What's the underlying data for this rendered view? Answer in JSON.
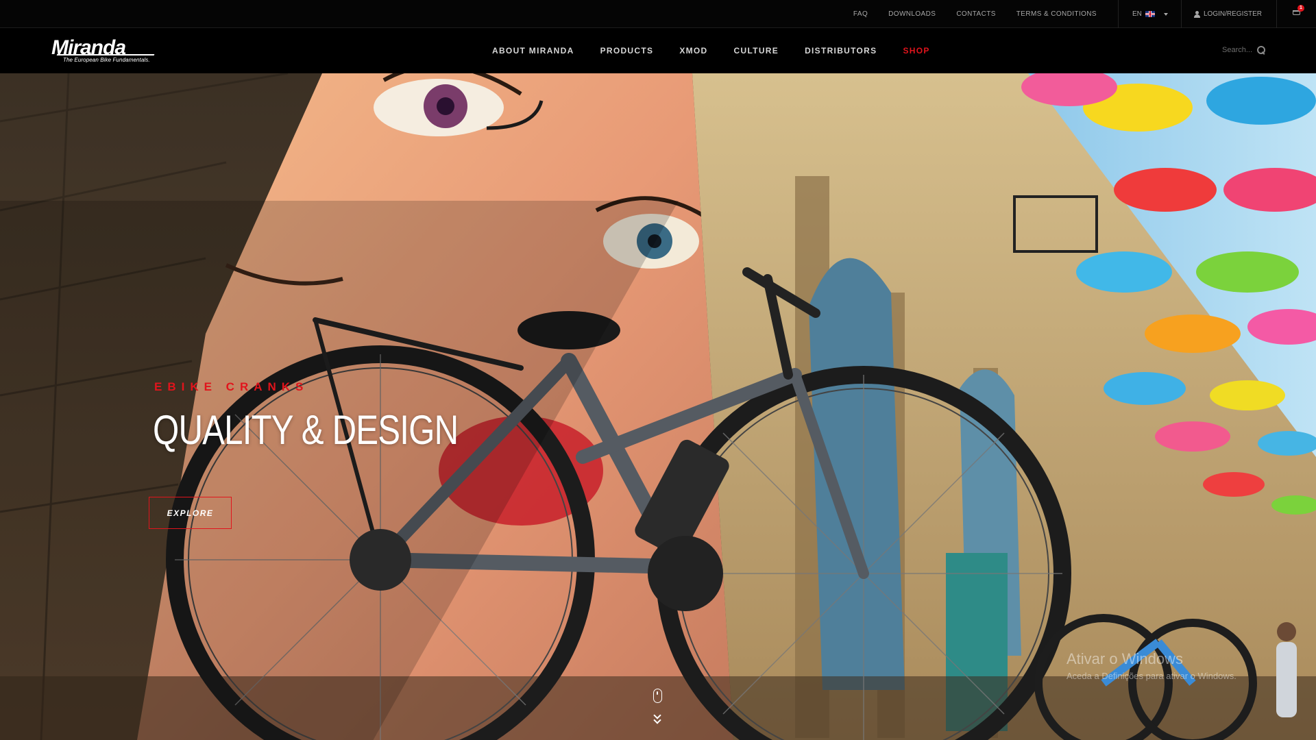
{
  "topbar": {
    "links": [
      "FAQ",
      "DOWNLOADS",
      "CONTACTS",
      "TERMS & CONDITIONS"
    ],
    "language": "EN",
    "login_label": "LOGIN/REGISTER",
    "cart_count": "1"
  },
  "nav": {
    "logo_word": "Miranda",
    "logo_tagline": "The European Bike Fundamentals.",
    "items": [
      "ABOUT MIRANDA",
      "PRODUCTS",
      "XMOD",
      "CULTURE",
      "DISTRIBUTORS",
      "SHOP"
    ],
    "search_placeholder": "Search..."
  },
  "hero": {
    "eyebrow": "EBIKE CRANKS",
    "headline": "QUALITY & DESIGN",
    "cta_label": "EXPLORE"
  },
  "watermark": {
    "line1": "Ativar o Windows",
    "line2": "Aceda a Definições para ativar o Windows."
  },
  "colors": {
    "accent": "#e1141c",
    "bar_bg": "#050505",
    "nav_text": "#d8d8d8"
  },
  "icons": [
    "flag-uk-icon",
    "chevron-down-icon",
    "user-icon",
    "cart-icon",
    "search-icon",
    "mouse-scroll-icon",
    "double-chevron-down-icon"
  ]
}
